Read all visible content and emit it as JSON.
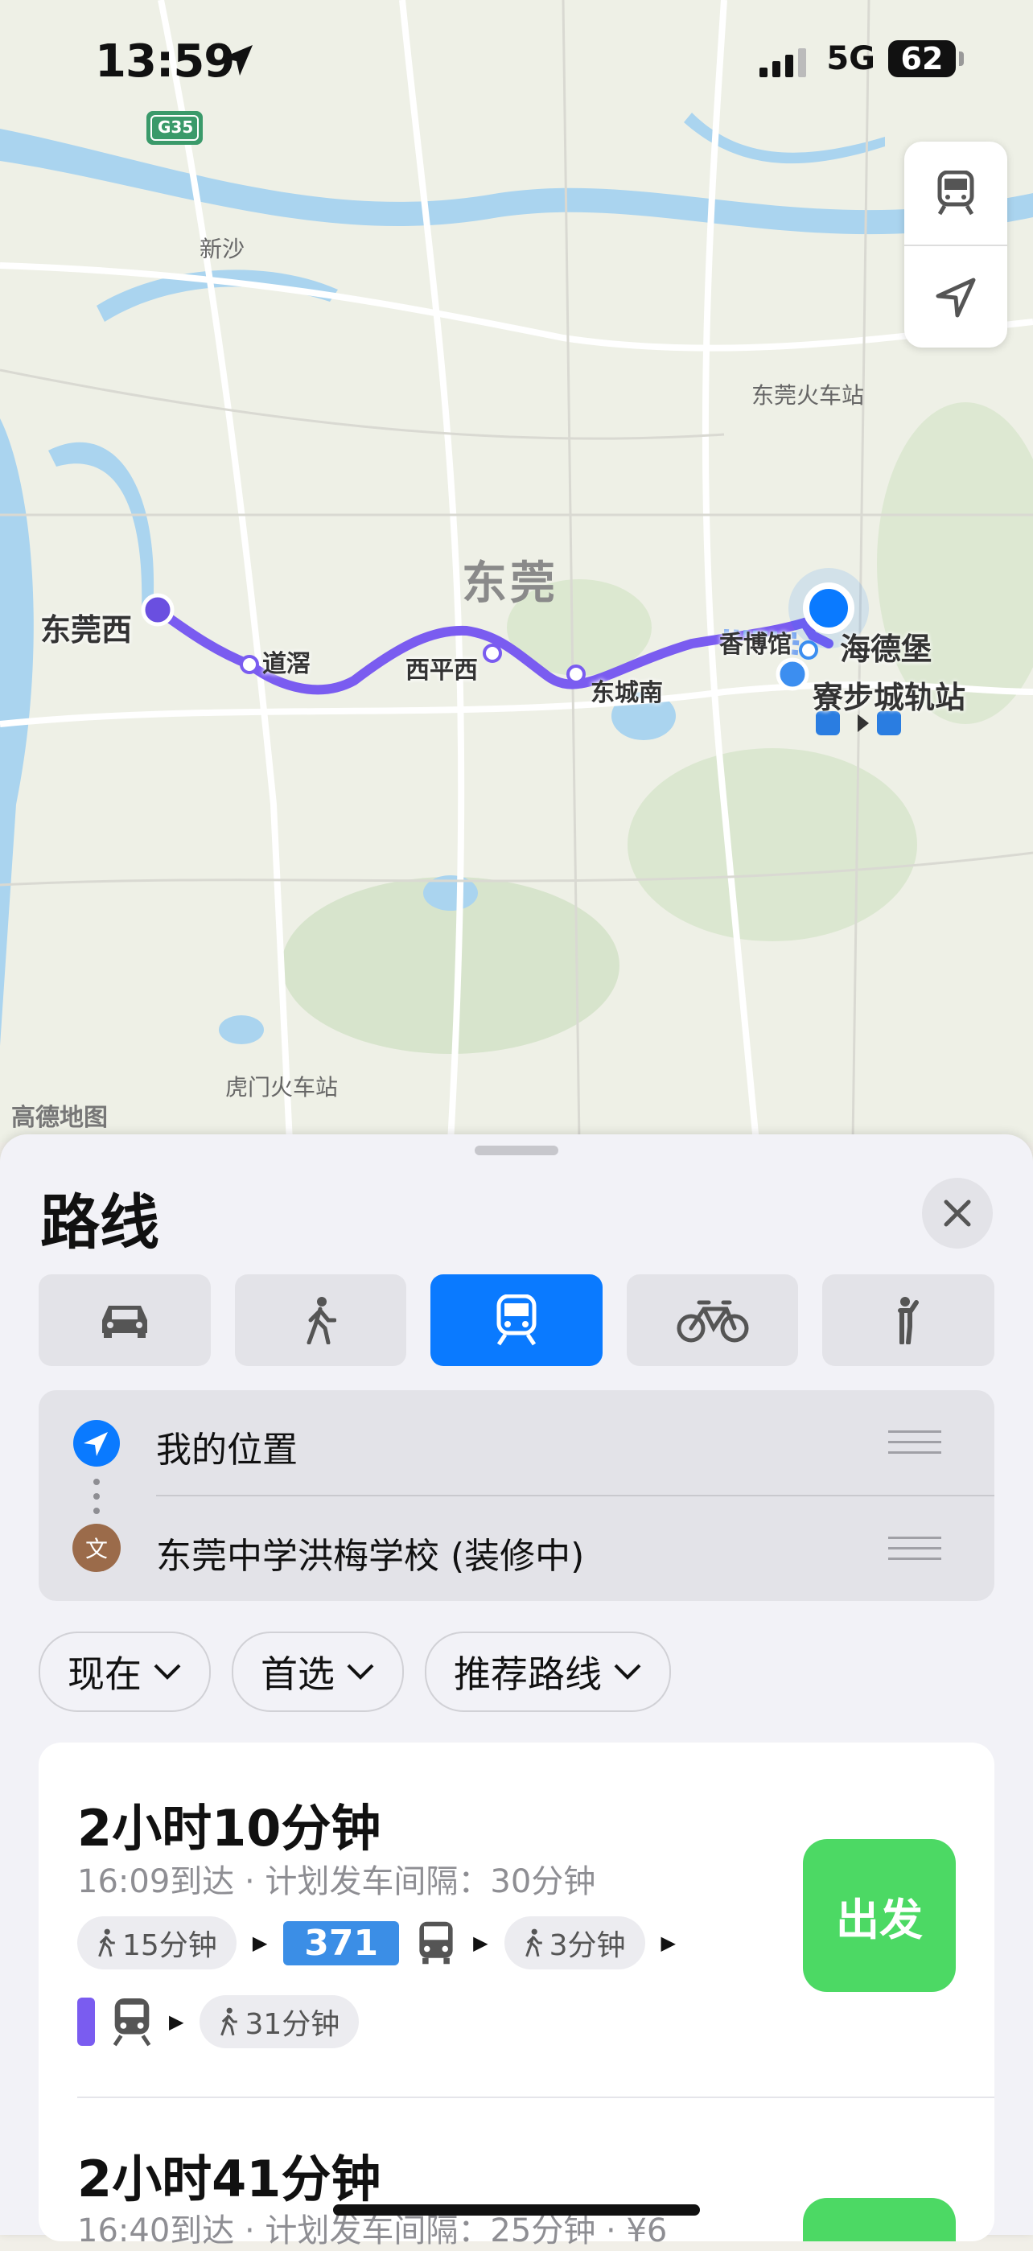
{
  "status_bar": {
    "time": "13:59",
    "network": "5G",
    "battery": "62"
  },
  "map": {
    "highway_shield": "G35",
    "labels": {
      "xinsha": "新沙",
      "dongguan_station": "东莞火车站",
      "humen_station": "虎门火车站"
    },
    "city": "东莞",
    "stations": {
      "origin": "东莞西",
      "s1": "道滘",
      "s2": "西平西",
      "s3": "东城南",
      "s4": "香博馆"
    },
    "places": {
      "p1": "海德堡",
      "p2": "寮步城轨站"
    },
    "provider": "高德地图",
    "controls": [
      "train-icon",
      "location-arrow-icon"
    ]
  },
  "sheet": {
    "title": "路线",
    "modes": [
      {
        "icon": "car-icon",
        "active": false
      },
      {
        "icon": "walk-icon",
        "active": false
      },
      {
        "icon": "transit-icon",
        "active": true
      },
      {
        "icon": "bike-icon",
        "active": false
      },
      {
        "icon": "person-icon",
        "active": false
      }
    ],
    "from": "我的位置",
    "to": "东莞中学洪梅学校 (装修中)",
    "to_badge": "文",
    "filters": [
      "现在",
      "首选",
      "推荐路线"
    ],
    "routes": [
      {
        "duration": "2小时10分钟",
        "summary": "16:09到达 · 计划发车间隔：30分钟",
        "walk1": "15分钟",
        "bus": "371",
        "walk2": "3分钟",
        "walk3": "31分钟",
        "go": "出发"
      },
      {
        "duration": "2小时41分钟",
        "summary": "16:40到达 · 计划发车间隔：25分钟 · ¥6"
      }
    ]
  },
  "colors": {
    "accent": "#0a7aff",
    "route": "#7a5cf0",
    "go": "#4cd964",
    "bus": "#3b8ee6"
  }
}
